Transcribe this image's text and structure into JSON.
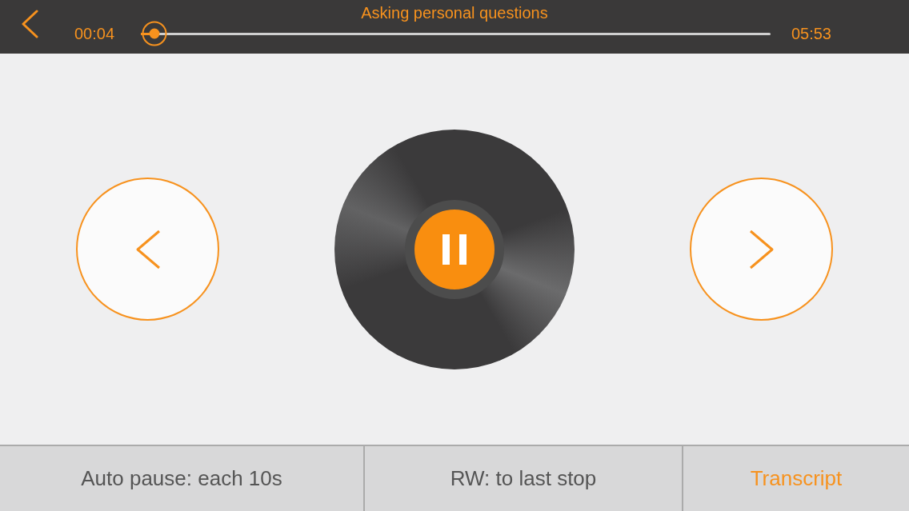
{
  "header": {
    "title": "Asking personal questions",
    "elapsed": "00:04",
    "duration": "05:53",
    "progress": {
      "level": 0.022
    }
  },
  "player": {
    "playing": true
  },
  "footer_buttons": [
    {
      "label": "Auto pause: each 10s",
      "kind": "setting"
    },
    {
      "label": "RW: to last stop",
      "kind": "setting"
    },
    {
      "label": "Transcript",
      "kind": "link"
    }
  ]
}
